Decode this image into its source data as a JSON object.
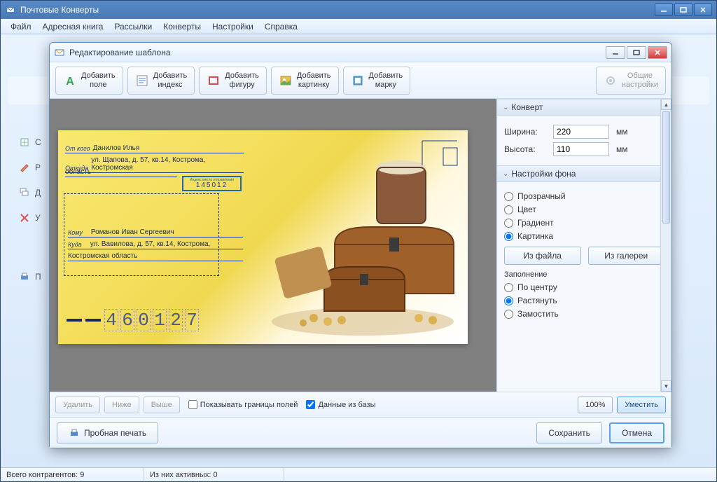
{
  "main": {
    "title": "Почтовые Конверты",
    "menu": [
      "Файл",
      "Адресная книга",
      "Рассылки",
      "Конверты",
      "Настройки",
      "Справка"
    ],
    "sidebar_hints": [
      "С",
      "Р",
      "Д",
      "У",
      "П"
    ],
    "status": {
      "total": "Всего контрагентов: 9",
      "active": "Из них активных: 0"
    }
  },
  "dialog": {
    "title": "Редактирование шаблона",
    "toolbar": {
      "add_field": "Добавить\nполе",
      "add_index": "Добавить\nиндекс",
      "add_shape": "Добавить\nфигуру",
      "add_image": "Добавить\nкартинку",
      "add_stamp": "Добавить\nмарку",
      "general_settings": "Общие\nнастройки"
    },
    "footer1": {
      "delete": "Удалить",
      "lower": "Ниже",
      "higher": "Выше",
      "show_bounds": "Показывать границы полей",
      "from_db": "Данные из базы",
      "zoom": "100%",
      "fit": "Уместить"
    },
    "footer2": {
      "test_print": "Пробная печать",
      "save": "Сохранить",
      "cancel": "Отмена"
    },
    "panel": {
      "envelope": {
        "header": "Конверт",
        "width_label": "Ширина:",
        "width": "220",
        "height_label": "Высота:",
        "height": "110",
        "unit": "мм"
      },
      "bg": {
        "header": "Настройки фона",
        "transparent": "Прозрачный",
        "color": "Цвет",
        "gradient": "Градиент",
        "image": "Картинка",
        "from_file": "Из файла",
        "from_gallery": "Из галереи",
        "fill_label": "Заполнение",
        "center": "По центру",
        "stretch": "Растянуть",
        "tile": "Замостить"
      }
    }
  },
  "envelope": {
    "from_label": "От кого",
    "from_name": "Данилов Илья",
    "from_addr_label": "Откуда",
    "from_addr": "ул. Щапова, д. 57, кв.14, Кострома, Костромская",
    "from_addr2": "область",
    "index_tiny": "Индекс места отправления",
    "index": "145012",
    "to_label": "Кому",
    "to_name": "Романов Иван Сергеевич",
    "to_addr_label": "Куда",
    "to_addr": "ул. Вавилова, д. 57, кв.14, Кострома,",
    "to_addr2": "Костромская область",
    "postal": "460127"
  }
}
